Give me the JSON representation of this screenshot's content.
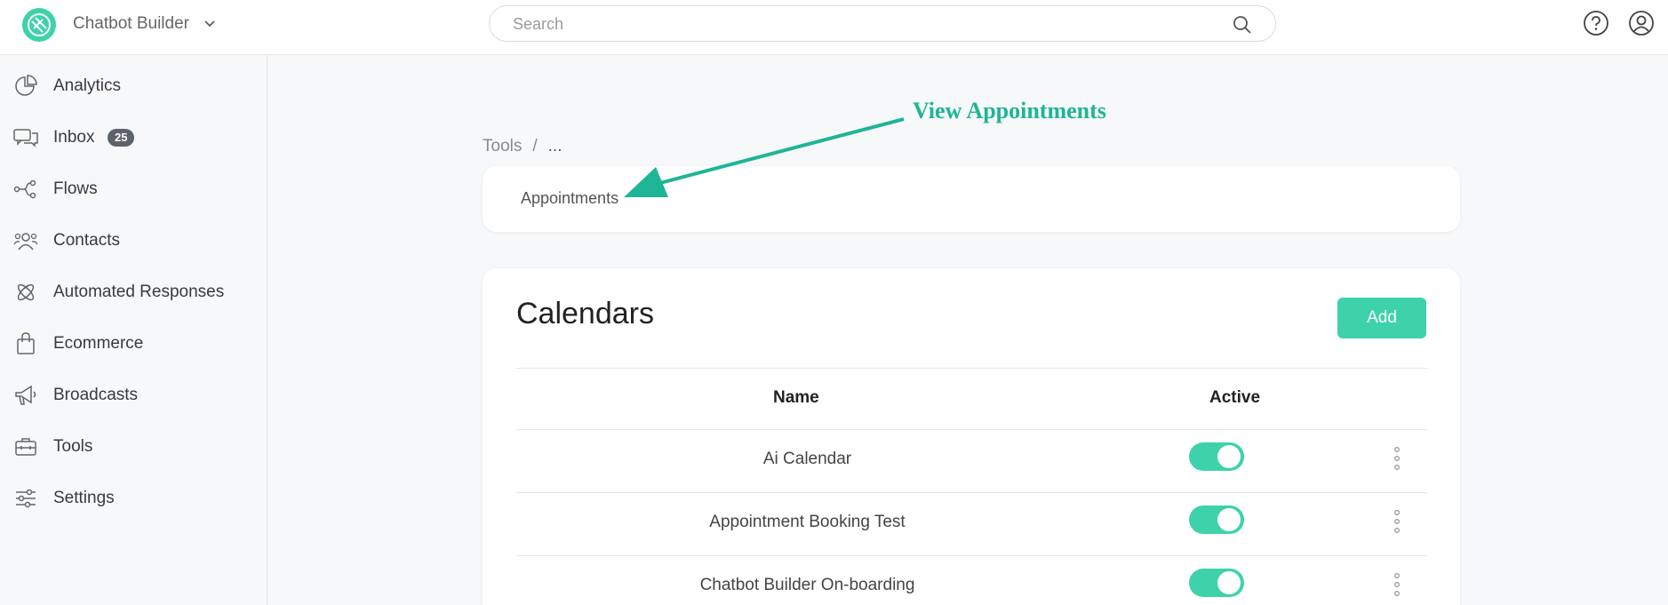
{
  "app": {
    "brand": "Chatbot Builder",
    "accent_color": "#3ed2aa"
  },
  "search": {
    "placeholder": "Search",
    "value": ""
  },
  "sidebar": {
    "items": [
      {
        "label": "Analytics",
        "icon": "pie-chart-icon"
      },
      {
        "label": "Inbox",
        "icon": "chat-bubbles-icon",
        "badge": "25"
      },
      {
        "label": "Flows",
        "icon": "flow-icon"
      },
      {
        "label": "Contacts",
        "icon": "people-icon"
      },
      {
        "label": "Automated Responses",
        "icon": "atom-icon"
      },
      {
        "label": "Ecommerce",
        "icon": "shopping-bag-icon"
      },
      {
        "label": "Broadcasts",
        "icon": "megaphone-icon"
      },
      {
        "label": "Tools",
        "icon": "toolbox-icon"
      },
      {
        "label": "Settings",
        "icon": "sliders-icon"
      }
    ]
  },
  "annotation": {
    "label": "View Appointments"
  },
  "breadcrumb": {
    "root": "Tools",
    "separator": "/",
    "current": "..."
  },
  "tabs": {
    "appointments": "Appointments"
  },
  "calendars": {
    "title": "Calendars",
    "add_label": "Add",
    "columns": {
      "name": "Name",
      "active": "Active"
    },
    "rows": [
      {
        "name": "Ai Calendar",
        "active": true
      },
      {
        "name": "Appointment Booking Test",
        "active": true
      },
      {
        "name": "Chatbot Builder On-boarding",
        "active": true
      }
    ]
  }
}
